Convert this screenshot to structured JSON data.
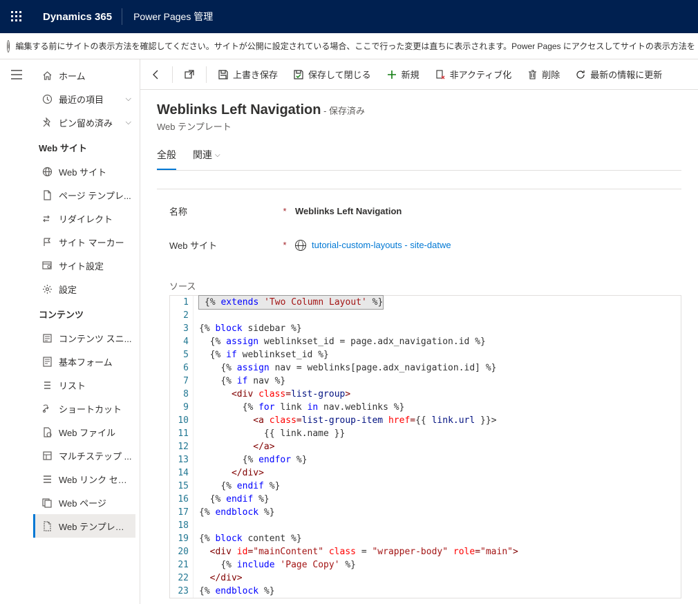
{
  "header": {
    "brand": "Dynamics 365",
    "appname": "Power Pages 管理"
  },
  "warning": "編集する前にサイトの表示方法を確認してください。サイトが公開に設定されている場合、ここで行った変更は直ちに表示されます。Power Pages にアクセスしてサイトの表示方法を",
  "sidebar": {
    "top": [
      {
        "icon": "home",
        "label": "ホーム"
      },
      {
        "icon": "clock",
        "label": "最近の項目",
        "chev": true
      },
      {
        "icon": "pin",
        "label": "ピン留め済み",
        "chev": true
      }
    ],
    "group1_title": "Web サイト",
    "group1": [
      {
        "icon": "globe",
        "label": "Web サイト"
      },
      {
        "icon": "page",
        "label": "ページ テンプレ..."
      },
      {
        "icon": "redirect",
        "label": "リダイレクト"
      },
      {
        "icon": "marker",
        "label": "サイト マーカー"
      },
      {
        "icon": "sitesettings",
        "label": "サイト設定"
      },
      {
        "icon": "gear",
        "label": "設定"
      }
    ],
    "group2_title": "コンテンツ",
    "group2": [
      {
        "icon": "snippet",
        "label": "コンテンツ スニ..."
      },
      {
        "icon": "form",
        "label": "基本フォーム"
      },
      {
        "icon": "list",
        "label": "リスト"
      },
      {
        "icon": "shortcut",
        "label": "ショートカット"
      },
      {
        "icon": "webfile",
        "label": "Web ファイル"
      },
      {
        "icon": "multistep",
        "label": "マルチステップ ..."
      },
      {
        "icon": "linkset",
        "label": "Web リンク セット"
      },
      {
        "icon": "webpage",
        "label": "Web ページ"
      },
      {
        "icon": "template",
        "label": "Web テンプレート",
        "selected": true
      }
    ]
  },
  "commands": {
    "save": "上書き保存",
    "saveclose": "保存して閉じる",
    "new": "新規",
    "deactivate": "非アクティブ化",
    "delete": "削除",
    "refresh": "最新の情報に更新"
  },
  "page": {
    "title": "Weblinks Left Navigation",
    "status": "- 保存済み",
    "subtitle": "Web テンプレート",
    "tabs": {
      "general": "全般",
      "related": "関連"
    },
    "fields": {
      "name_label": "名称",
      "name_value": "Weblinks Left Navigation",
      "website_label": "Web サイト",
      "website_value": "tutorial-custom-layouts - site-datwe"
    },
    "source_label": "ソース"
  },
  "code": {
    "lines": [
      {
        "n": 1,
        "tokens": [
          [
            "d",
            "{%"
          ],
          [
            "c",
            " "
          ],
          [
            "k",
            "extends"
          ],
          [
            "c",
            " "
          ],
          [
            "s",
            "'Two Column Layout'"
          ],
          [
            "c",
            " "
          ],
          [
            "d",
            "%}"
          ]
        ],
        "hl": true
      },
      {
        "n": 2,
        "tokens": []
      },
      {
        "n": 3,
        "tokens": [
          [
            "d",
            "{%"
          ],
          [
            "c",
            " "
          ],
          [
            "k",
            "block"
          ],
          [
            "c",
            " sidebar "
          ],
          [
            "d",
            "%}"
          ]
        ]
      },
      {
        "n": 4,
        "tokens": [
          [
            "c",
            "  "
          ],
          [
            "d",
            "{%"
          ],
          [
            "c",
            " "
          ],
          [
            "k",
            "assign"
          ],
          [
            "c",
            " weblinkset_id = page.adx_navigation.id "
          ],
          [
            "d",
            "%}"
          ]
        ]
      },
      {
        "n": 5,
        "tokens": [
          [
            "c",
            "  "
          ],
          [
            "d",
            "{%"
          ],
          [
            "c",
            " "
          ],
          [
            "k",
            "if"
          ],
          [
            "c",
            " weblinkset_id "
          ],
          [
            "d",
            "%}"
          ]
        ]
      },
      {
        "n": 6,
        "tokens": [
          [
            "c",
            "    "
          ],
          [
            "d",
            "{%"
          ],
          [
            "c",
            " "
          ],
          [
            "k",
            "assign"
          ],
          [
            "c",
            " nav = weblinks[page.adx_navigation.id] "
          ],
          [
            "d",
            "%}"
          ]
        ]
      },
      {
        "n": 7,
        "tokens": [
          [
            "c",
            "    "
          ],
          [
            "d",
            "{%"
          ],
          [
            "c",
            " "
          ],
          [
            "k",
            "if"
          ],
          [
            "c",
            " nav "
          ],
          [
            "d",
            "%}"
          ]
        ]
      },
      {
        "n": 8,
        "tokens": [
          [
            "c",
            "      "
          ],
          [
            "t",
            "<div "
          ],
          [
            "a",
            "class"
          ],
          [
            "t",
            "="
          ],
          [
            "v",
            "list-group"
          ],
          [
            "t",
            ">"
          ]
        ]
      },
      {
        "n": 9,
        "tokens": [
          [
            "c",
            "        "
          ],
          [
            "d",
            "{%"
          ],
          [
            "c",
            " "
          ],
          [
            "k",
            "for"
          ],
          [
            "c",
            " link "
          ],
          [
            "k",
            "in"
          ],
          [
            "c",
            " nav.weblinks "
          ],
          [
            "d",
            "%}"
          ]
        ]
      },
      {
        "n": 10,
        "tokens": [
          [
            "c",
            "          "
          ],
          [
            "t",
            "<a "
          ],
          [
            "a",
            "class"
          ],
          [
            "t",
            "="
          ],
          [
            "v",
            "list-group-item"
          ],
          [
            "c",
            " "
          ],
          [
            "a",
            "href"
          ],
          [
            "t",
            "="
          ],
          [
            "c",
            "{{ "
          ],
          [
            "v",
            "link.url"
          ],
          [
            "c",
            " }}>"
          ]
        ]
      },
      {
        "n": 11,
        "tokens": [
          [
            "c",
            "            {{ link.name }}"
          ]
        ]
      },
      {
        "n": 12,
        "tokens": [
          [
            "c",
            "          "
          ],
          [
            "t",
            "</a>"
          ]
        ]
      },
      {
        "n": 13,
        "tokens": [
          [
            "c",
            "        "
          ],
          [
            "d",
            "{%"
          ],
          [
            "c",
            " "
          ],
          [
            "k",
            "endfor"
          ],
          [
            "c",
            " "
          ],
          [
            "d",
            "%}"
          ]
        ]
      },
      {
        "n": 14,
        "tokens": [
          [
            "c",
            "      "
          ],
          [
            "t",
            "</div>"
          ]
        ]
      },
      {
        "n": 15,
        "tokens": [
          [
            "c",
            "    "
          ],
          [
            "d",
            "{%"
          ],
          [
            "c",
            " "
          ],
          [
            "k",
            "endif"
          ],
          [
            "c",
            " "
          ],
          [
            "d",
            "%}"
          ]
        ]
      },
      {
        "n": 16,
        "tokens": [
          [
            "c",
            "  "
          ],
          [
            "d",
            "{%"
          ],
          [
            "c",
            " "
          ],
          [
            "k",
            "endif"
          ],
          [
            "c",
            " "
          ],
          [
            "d",
            "%}"
          ]
        ]
      },
      {
        "n": 17,
        "tokens": [
          [
            "d",
            "{%"
          ],
          [
            "c",
            " "
          ],
          [
            "k",
            "endblock"
          ],
          [
            "c",
            " "
          ],
          [
            "d",
            "%}"
          ]
        ]
      },
      {
        "n": 18,
        "tokens": []
      },
      {
        "n": 19,
        "tokens": [
          [
            "d",
            "{%"
          ],
          [
            "c",
            " "
          ],
          [
            "k",
            "block"
          ],
          [
            "c",
            " content "
          ],
          [
            "d",
            "%}"
          ]
        ]
      },
      {
        "n": 20,
        "tokens": [
          [
            "c",
            "  "
          ],
          [
            "t",
            "<div "
          ],
          [
            "a",
            "id"
          ],
          [
            "t",
            "="
          ],
          [
            "s",
            "\"mainContent\""
          ],
          [
            "c",
            " "
          ],
          [
            "a",
            "class"
          ],
          [
            "c",
            " = "
          ],
          [
            "s",
            "\"wrapper-body\""
          ],
          [
            "c",
            " "
          ],
          [
            "a",
            "role"
          ],
          [
            "t",
            "="
          ],
          [
            "s",
            "\"main\""
          ],
          [
            "t",
            ">"
          ]
        ]
      },
      {
        "n": 21,
        "tokens": [
          [
            "c",
            "    "
          ],
          [
            "d",
            "{%"
          ],
          [
            "c",
            " "
          ],
          [
            "k",
            "include"
          ],
          [
            "c",
            " "
          ],
          [
            "s",
            "'Page Copy'"
          ],
          [
            "c",
            " "
          ],
          [
            "d",
            "%}"
          ]
        ]
      },
      {
        "n": 22,
        "tokens": [
          [
            "c",
            "  "
          ],
          [
            "t",
            "</div>"
          ]
        ]
      },
      {
        "n": 23,
        "tokens": [
          [
            "d",
            "{%"
          ],
          [
            "c",
            " "
          ],
          [
            "k",
            "endblock"
          ],
          [
            "c",
            " "
          ],
          [
            "d",
            "%}"
          ]
        ]
      }
    ]
  }
}
